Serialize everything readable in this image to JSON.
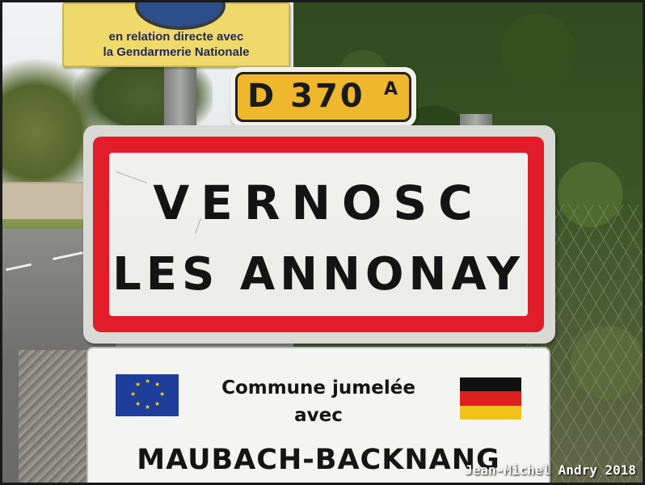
{
  "top_sign": {
    "line1": "en relation directe avec",
    "line2": "la Gendarmerie Nationale"
  },
  "road_plate": {
    "number": "D 370",
    "suffix": "A"
  },
  "town_sign": {
    "line1": "VERNOSC",
    "line2": "LES ANNONAY",
    "border_color": "#e21d2a"
  },
  "twin_sign": {
    "line1": "Commune jumelée",
    "line2": "avec",
    "twin_town": "MAUBACH-BACKNANG",
    "flags": [
      "eu-flag",
      "german-flag"
    ]
  },
  "credit": "Jean-Michel Andry 2018"
}
